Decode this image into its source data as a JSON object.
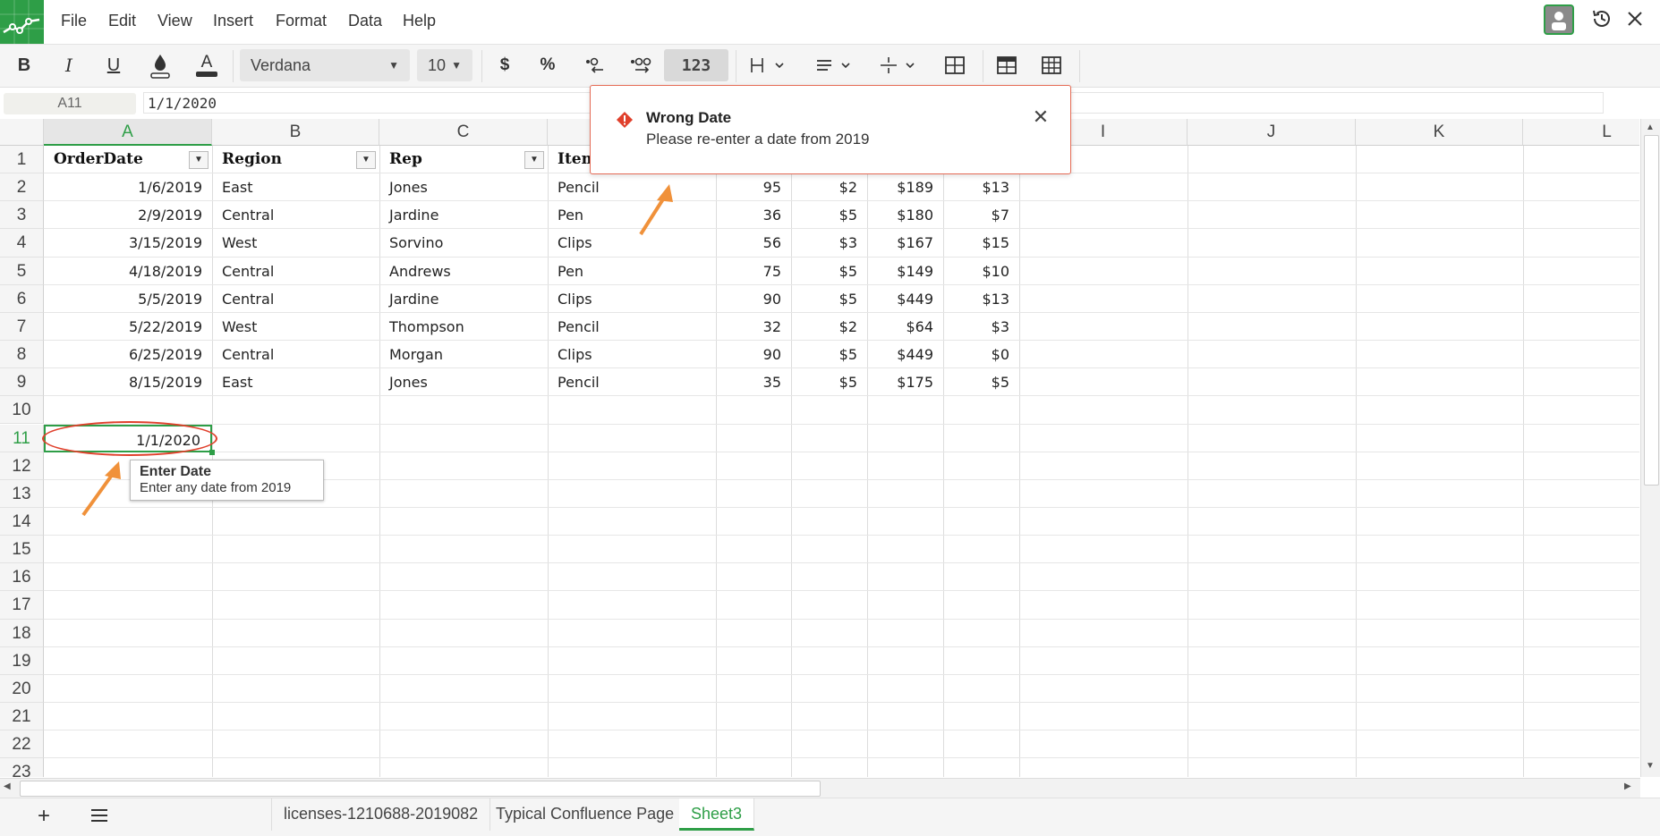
{
  "menu": {
    "items": [
      "File",
      "Edit",
      "View",
      "Insert",
      "Format",
      "Data",
      "Help"
    ]
  },
  "toolbar": {
    "bold": "B",
    "italic": "I",
    "underline": "U",
    "font_color_letter": "A",
    "font_name": "Verdana",
    "font_size": "10",
    "currency": "$",
    "percent": "%",
    "number_format": "123"
  },
  "formula_bar": {
    "cell_ref": "A11",
    "value": "1/1/2020"
  },
  "grid": {
    "columns": [
      "A",
      "B",
      "C",
      "",
      "",
      "",
      "",
      "",
      "I",
      "J",
      "K",
      "L"
    ],
    "rows": [
      "1",
      "2",
      "3",
      "4",
      "5",
      "6",
      "7",
      "8",
      "9",
      "10",
      "11",
      "12",
      "13",
      "14",
      "15",
      "16",
      "17",
      "18",
      "19",
      "20",
      "21",
      "22",
      "23"
    ],
    "headers": [
      "OrderDate",
      "Region",
      "Rep",
      "Item"
    ],
    "data": [
      [
        "1/6/2019",
        "East",
        "Jones",
        "Pencil",
        "95",
        "$2",
        "$189",
        "$13"
      ],
      [
        "2/9/2019",
        "Central",
        "Jardine",
        "Pen",
        "36",
        "$5",
        "$180",
        "$7"
      ],
      [
        "3/15/2019",
        "West",
        "Sorvino",
        "Clips",
        "56",
        "$3",
        "$167",
        "$15"
      ],
      [
        "4/18/2019",
        "Central",
        "Andrews",
        "Pen",
        "75",
        "$5",
        "$149",
        "$10"
      ],
      [
        "5/5/2019",
        "Central",
        "Jardine",
        "Clips",
        "90",
        "$5",
        "$449",
        "$13"
      ],
      [
        "5/22/2019",
        "West",
        "Thompson",
        "Pencil",
        "32",
        "$2",
        "$64",
        "$3"
      ],
      [
        "6/25/2019",
        "Central",
        "Morgan",
        "Clips",
        "90",
        "$5",
        "$449",
        "$0"
      ],
      [
        "8/15/2019",
        "East",
        "Jones",
        "Pencil",
        "35",
        "$5",
        "$175",
        "$5"
      ]
    ],
    "selected_value": "1/1/2020"
  },
  "tooltip": {
    "title": "Enter Date",
    "message": "Enter any date from 2019"
  },
  "alert": {
    "title": "Wrong Date",
    "message": "Please re-enter a date from 2019",
    "close": "✕"
  },
  "tabs": [
    {
      "label": "licenses-1210688-2019082",
      "active": false
    },
    {
      "label": "Typical Confluence Page",
      "active": false
    },
    {
      "label": "Sheet3",
      "active": true
    }
  ],
  "colors": {
    "accent": "#2e9e47",
    "error": "#e0402c",
    "arrow": "#f0913a"
  }
}
